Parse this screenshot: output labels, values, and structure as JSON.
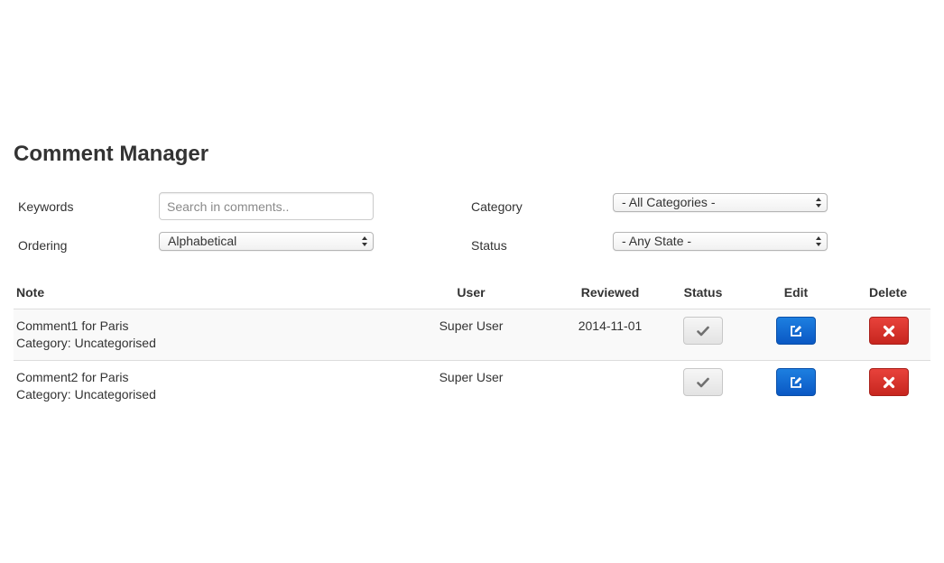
{
  "page": {
    "title": "Comment Manager"
  },
  "filters": {
    "keywords_label": "Keywords",
    "keywords_placeholder": "Search in comments..",
    "ordering_label": "Ordering",
    "ordering_value": "Alphabetical",
    "category_label": "Category",
    "category_value": "- All Categories -",
    "status_label": "Status",
    "status_value": "- Any State -"
  },
  "table": {
    "headers": {
      "note": "Note",
      "user": "User",
      "reviewed": "Reviewed",
      "status": "Status",
      "edit": "Edit",
      "delete": "Delete"
    },
    "rows": [
      {
        "note": "Comment1 for Paris",
        "category": "Category: Uncategorised",
        "user": "Super User",
        "reviewed": "2014-11-01"
      },
      {
        "note": "Comment2 for Paris",
        "category": "Category: Uncategorised",
        "user": "Super User",
        "reviewed": ""
      }
    ]
  },
  "icons": {
    "status": "check-icon",
    "edit": "edit-icon",
    "delete": "close-icon"
  },
  "colors": {
    "edit_button": "#0a58c4",
    "delete_button": "#c7261f",
    "status_button": "#e8e8e8"
  }
}
